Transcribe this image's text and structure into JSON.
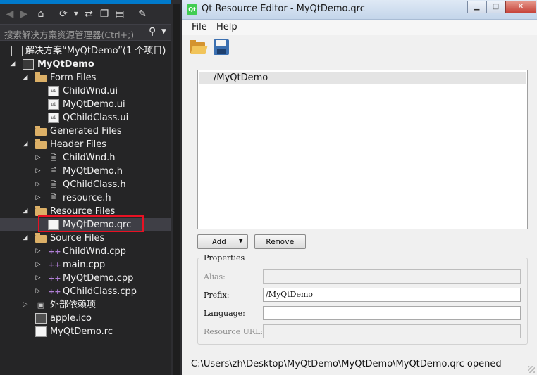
{
  "solution_explorer": {
    "search_placeholder": "搜索解决方案资源管理器(Ctrl+;)",
    "tree": [
      {
        "label": "解决方案“MyQtDemo”(1 个项目)",
        "icon": "solution-icon",
        "expander": ""
      },
      {
        "label": "MyQtDemo",
        "icon": "project-icon",
        "expander": "expanded"
      },
      {
        "label": "Form Files",
        "icon": "filter-folder-icon",
        "expander": "expanded"
      },
      {
        "label": "ChildWnd.ui",
        "icon": "ui-file-icon",
        "expander": ""
      },
      {
        "label": "MyQtDemo.ui",
        "icon": "ui-file-icon",
        "expander": ""
      },
      {
        "label": "QChildClass.ui",
        "icon": "ui-file-icon",
        "expander": ""
      },
      {
        "label": "Generated Files",
        "icon": "filter-folder-icon",
        "expander": ""
      },
      {
        "label": "Header Files",
        "icon": "filter-folder-icon",
        "expander": "expanded"
      },
      {
        "label": "ChildWnd.h",
        "icon": "header-file-icon",
        "expander": "collapsed"
      },
      {
        "label": "MyQtDemo.h",
        "icon": "header-file-icon",
        "expander": "collapsed"
      },
      {
        "label": "QChildClass.h",
        "icon": "header-file-icon",
        "expander": "collapsed"
      },
      {
        "label": "resource.h",
        "icon": "header-file-icon",
        "expander": "collapsed"
      },
      {
        "label": "Resource Files",
        "icon": "filter-folder-icon",
        "expander": "expanded"
      },
      {
        "label": "MyQtDemo.qrc",
        "icon": "qrc-file-icon",
        "expander": "",
        "selected": true
      },
      {
        "label": "Source Files",
        "icon": "filter-folder-icon",
        "expander": "expanded"
      },
      {
        "label": "ChildWnd.cpp",
        "icon": "cpp-file-icon",
        "expander": "collapsed"
      },
      {
        "label": "main.cpp",
        "icon": "cpp-file-icon",
        "expander": "collapsed"
      },
      {
        "label": "MyQtDemo.cpp",
        "icon": "cpp-file-icon",
        "expander": "collapsed"
      },
      {
        "label": "QChildClass.cpp",
        "icon": "cpp-file-icon",
        "expander": "collapsed"
      },
      {
        "label": "外部依赖项",
        "icon": "external-deps-icon",
        "expander": "collapsed"
      },
      {
        "label": "apple.ico",
        "icon": "image-file-icon",
        "expander": ""
      },
      {
        "label": "MyQtDemo.rc",
        "icon": "rc-file-icon",
        "expander": ""
      }
    ]
  },
  "qt_editor": {
    "title": "Qt Resource Editor - MyQtDemo.qrc",
    "app_icon_text": "Qt",
    "menu": [
      "File",
      "Help"
    ],
    "prefix_item": "/MyQtDemo",
    "buttons": {
      "add": "Add",
      "remove": "Remove"
    },
    "properties": {
      "title": "Properties",
      "alias_label": "Alias:",
      "alias_value": "",
      "prefix_label": "Prefix:",
      "prefix_value": "/MyQtDemo",
      "language_label": "Language:",
      "language_value": "",
      "resource_url_label": "Resource URL:",
      "resource_url_value": ""
    },
    "status": "C:\\Users\\zh\\Desktop\\MyQtDemo\\MyQtDemo\\MyQtDemo.qrc opened"
  },
  "colors": {
    "vs_background": "#252526",
    "vs_accent": "#007acc",
    "selection_highlight": "#e81123",
    "qt_background": "#f0f0f0"
  }
}
